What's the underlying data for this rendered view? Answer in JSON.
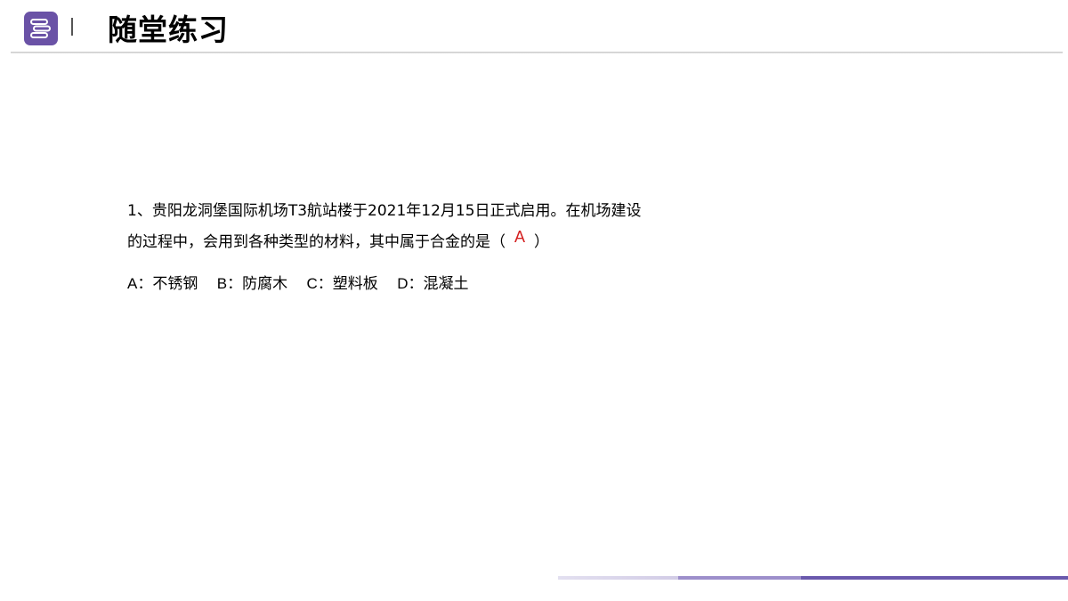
{
  "header": {
    "title": "随堂练习",
    "icon": "stacked-books-icon",
    "accent_color": "#6a52a6"
  },
  "question": {
    "line1": "1、贵阳龙洞堡国际机场T3航站楼于2021年12月15日正式启用。在机场建设",
    "line2_before": "的过程中，会用到各种类型的材料，其中属于合金的是（",
    "answer": "A",
    "line2_after": "）",
    "answer_color": "#d42020"
  },
  "options": [
    {
      "letter": "A：",
      "text": "不锈钢"
    },
    {
      "letter": "B：",
      "text": "防腐木"
    },
    {
      "letter": "C：",
      "text": "塑料板"
    },
    {
      "letter": "D：",
      "text": "混凝土"
    }
  ],
  "footer": {
    "bar_colors": [
      "#d9d4ea",
      "#9d8fcb",
      "#6a59ad"
    ]
  }
}
